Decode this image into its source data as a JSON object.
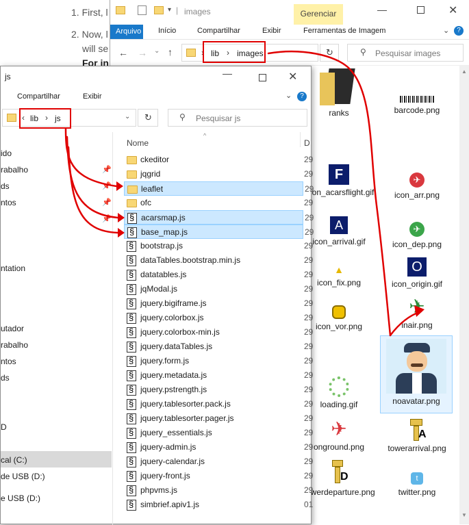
{
  "doc": {
    "line1": "1. First, l",
    "line2": "2. Now, l",
    "line3": "will se",
    "line4": "For in"
  },
  "back_window": {
    "title": "images",
    "contextual_tab": "Gerenciar",
    "ribbon_tabs": [
      "Arquivo",
      "Início",
      "Compartilhar",
      "Exibir",
      "Ferramentas de Imagem"
    ],
    "breadcrumb": [
      "lib",
      "images"
    ],
    "search_placeholder": "Pesquisar images",
    "items": [
      {
        "name": "ranks",
        "icon": "folder-dark-icon"
      },
      {
        "name": "barcode.png",
        "icon": "barcode-icon"
      },
      {
        "name": "icon_acarsflight.gif",
        "icon": "letter-f-icon"
      },
      {
        "name": "icon_arr.png",
        "icon": "plane-red-icon"
      },
      {
        "name": "icon_arrival.gif",
        "icon": "letter-a-icon"
      },
      {
        "name": "icon_dep.png",
        "icon": "plane-green-icon"
      },
      {
        "name": "icon_fix.png",
        "icon": "triangle-icon"
      },
      {
        "name": "icon_origin.gif",
        "icon": "letter-o-icon"
      },
      {
        "name": "icon_vor.png",
        "icon": "vor-icon"
      },
      {
        "name": "inair.png",
        "icon": "plane-inair-icon"
      },
      {
        "name": "loading.gif",
        "icon": "spinner-icon"
      },
      {
        "name": "noavatar.png",
        "icon": "pilot-avatar-icon"
      },
      {
        "name": "onground.png",
        "icon": "plane-ground-icon"
      },
      {
        "name": "towerarrival.png",
        "icon": "tower-a-icon"
      },
      {
        "name": "owerdeparture.png",
        "icon": "tower-d-icon"
      },
      {
        "name": "twitter.png",
        "icon": "twitter-icon"
      }
    ]
  },
  "front_window": {
    "title": "js",
    "ribbon_tabs": [
      "Compartilhar",
      "Exibir"
    ],
    "breadcrumb": [
      "lib",
      "js"
    ],
    "search_placeholder": "Pesquisar js",
    "column_name": "Nome",
    "column_date": "D",
    "sidebar": [
      "ido",
      "rabalho",
      "ds",
      "ntos",
      "ntation",
      "utador",
      "rabalho",
      "ntos",
      "ds",
      "D",
      "cal (C:)",
      "de USB (D:)",
      "e USB (D:)"
    ],
    "files": [
      {
        "name": "ckeditor",
        "type": "folder",
        "date": "29",
        "selected": false
      },
      {
        "name": "jqgrid",
        "type": "folder",
        "date": "29",
        "selected": false
      },
      {
        "name": "leaflet",
        "type": "folder",
        "date": "29",
        "selected": true
      },
      {
        "name": "ofc",
        "type": "folder",
        "date": "29",
        "selected": false
      },
      {
        "name": "acarsmap.js",
        "type": "js",
        "date": "29",
        "selected": true
      },
      {
        "name": "base_map.js",
        "type": "js",
        "date": "29",
        "selected": true
      },
      {
        "name": "bootstrap.js",
        "type": "js",
        "date": "29",
        "selected": false
      },
      {
        "name": "dataTables.bootstrap.min.js",
        "type": "js",
        "date": "29",
        "selected": false
      },
      {
        "name": "datatables.js",
        "type": "js",
        "date": "29",
        "selected": false
      },
      {
        "name": "jqModal.js",
        "type": "js",
        "date": "29",
        "selected": false
      },
      {
        "name": "jquery.bigiframe.js",
        "type": "js",
        "date": "29",
        "selected": false
      },
      {
        "name": "jquery.colorbox.js",
        "type": "js",
        "date": "29",
        "selected": false
      },
      {
        "name": "jquery.colorbox-min.js",
        "type": "js",
        "date": "29",
        "selected": false
      },
      {
        "name": "jquery.dataTables.js",
        "type": "js",
        "date": "29",
        "selected": false
      },
      {
        "name": "jquery.form.js",
        "type": "js",
        "date": "29",
        "selected": false
      },
      {
        "name": "jquery.metadata.js",
        "type": "js",
        "date": "29",
        "selected": false
      },
      {
        "name": "jquery.pstrength.js",
        "type": "js",
        "date": "29",
        "selected": false
      },
      {
        "name": "jquery.tablesorter.pack.js",
        "type": "js",
        "date": "29",
        "selected": false
      },
      {
        "name": "jquery.tablesorter.pager.js",
        "type": "js",
        "date": "29",
        "selected": false
      },
      {
        "name": "jquery_essentials.js",
        "type": "js",
        "date": "29",
        "selected": false
      },
      {
        "name": "jquery-admin.js",
        "type": "js",
        "date": "29",
        "selected": false
      },
      {
        "name": "jquery-calendar.js",
        "type": "js",
        "date": "29",
        "selected": false
      },
      {
        "name": "jquery-front.js",
        "type": "js",
        "date": "29",
        "selected": false
      },
      {
        "name": "phpvms.js",
        "type": "js",
        "date": "29",
        "selected": false
      },
      {
        "name": "simbrief.apiv1.js",
        "type": "js",
        "date": "01",
        "selected": false
      }
    ]
  },
  "colors": {
    "annotation_red": "#e00000",
    "selection": "#cce8ff",
    "arquivo_blue": "#1979ca",
    "gerenciar_bg": "#fff1a8"
  }
}
